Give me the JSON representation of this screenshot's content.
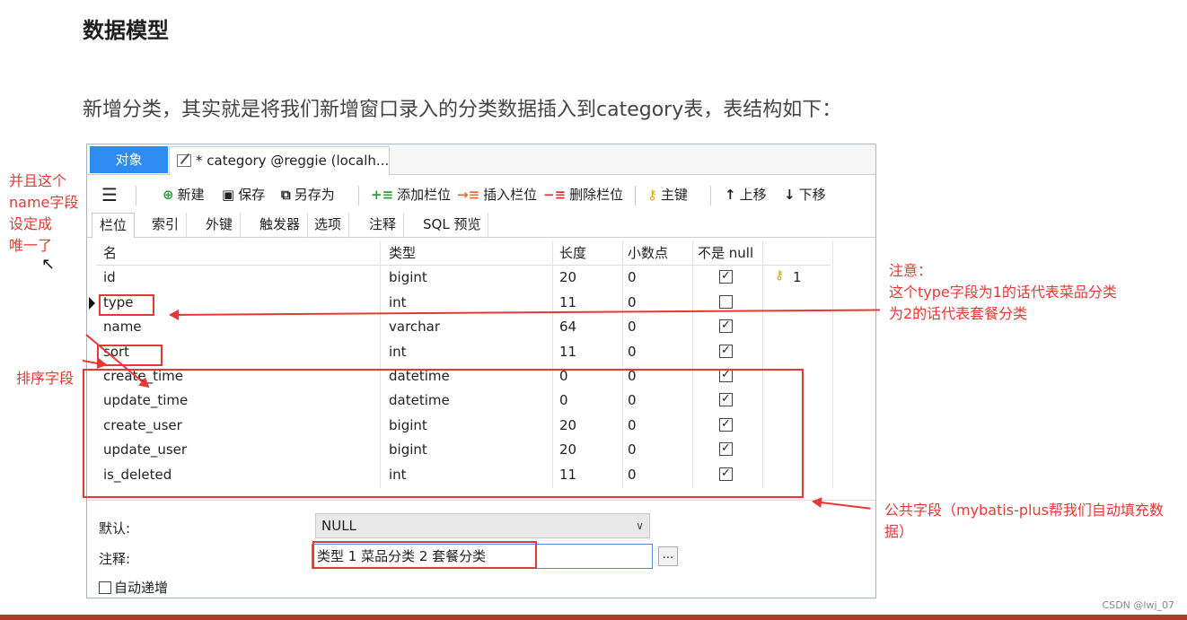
{
  "heading": "数据模型",
  "intro": "新增分类，其实就是将我们新增窗口录入的分类数据插入到category表，表结构如下：",
  "window": {
    "tab_objects": "对象",
    "tab_doc": "* category @reggie (localh...",
    "toolbar": {
      "new": "新建",
      "save": "保存",
      "save_as": "另存为",
      "add_field": "添加栏位",
      "insert_field": "插入栏位",
      "delete_field": "删除栏位",
      "primary_key": "主键",
      "move_up": "上移",
      "move_down": "下移"
    },
    "subtabs": [
      "栏位",
      "索引",
      "外键",
      "触发器",
      "选项",
      "注释",
      "SQL 预览"
    ],
    "columns": [
      "名",
      "类型",
      "长度",
      "小数点",
      "不是 null",
      ""
    ],
    "rows": [
      {
        "name": "id",
        "type": "bigint",
        "length": "20",
        "decimal": "0",
        "not_null": true,
        "key": "1"
      },
      {
        "name": "type",
        "type": "int",
        "length": "11",
        "decimal": "0",
        "not_null": false,
        "key": ""
      },
      {
        "name": "name",
        "type": "varchar",
        "length": "64",
        "decimal": "0",
        "not_null": true,
        "key": ""
      },
      {
        "name": "sort",
        "type": "int",
        "length": "11",
        "decimal": "0",
        "not_null": true,
        "key": ""
      },
      {
        "name": "create_time",
        "type": "datetime",
        "length": "0",
        "decimal": "0",
        "not_null": true,
        "key": ""
      },
      {
        "name": "update_time",
        "type": "datetime",
        "length": "0",
        "decimal": "0",
        "not_null": true,
        "key": ""
      },
      {
        "name": "create_user",
        "type": "bigint",
        "length": "20",
        "decimal": "0",
        "not_null": true,
        "key": ""
      },
      {
        "name": "update_user",
        "type": "bigint",
        "length": "20",
        "decimal": "0",
        "not_null": true,
        "key": ""
      },
      {
        "name": "is_deleted",
        "type": "int",
        "length": "11",
        "decimal": "0",
        "not_null": true,
        "key": ""
      }
    ],
    "default_label": "默认:",
    "default_value": "NULL",
    "comment_label": "注释:",
    "comment_value": "类型   1 菜品分类 2 套餐分类",
    "ellipsis": "...",
    "auto_increment": "自动递增"
  },
  "notes": {
    "unique_lines": [
      "并且这个",
      "name字段",
      "设定成",
      "唯一了"
    ],
    "sort_note": "排序字段",
    "type_note_lines": [
      "注意：",
      "这个type字段为1的话代表菜品分类",
      "为2的话代表套餐分类"
    ],
    "common_note_lines": [
      "公共字段（mybatis-plus帮我们自动填充数",
      "据）"
    ]
  },
  "watermark": "CSDN @lwj_07"
}
